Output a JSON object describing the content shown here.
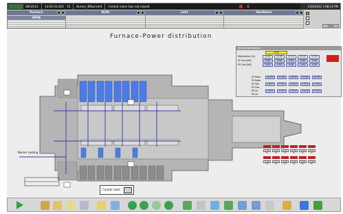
{
  "topbar": {
    "alarm_date": "08/10/12",
    "alarm_time": "14:02:03.625",
    "alarm_count": "15",
    "alarm_source": "Burner_Bfburner6",
    "alarm_message": "Control valve Gas not closed",
    "alarm_code": "E",
    "datetime": "23/4/2012 1:08:33 PM"
  },
  "groups": [
    {
      "title": "Furnace",
      "sub": "EPHA"
    },
    {
      "title": "Bath",
      "sub": ""
    },
    {
      "title": "Lehr",
      "sub": ""
    },
    {
      "title": "Hardware",
      "sub": ""
    }
  ],
  "controls": {
    "select_label": "Qind"
  },
  "main": {
    "title": "Furnace-Power distribution",
    "burner_label": "Burner cooling",
    "control_room_label": "Control room"
  },
  "params": {
    "header": "Window Workstation",
    "mode_value": "0.00",
    "rows": [
      {
        "label": "Distribution [%]",
        "values": [
          "20.00",
          "20.00",
          "20.00",
          "20.00",
          "20.00"
        ]
      },
      {
        "label": "SP Gas [kW]",
        "values": [
          "0.64",
          "0.64",
          "0.64",
          "0.64",
          "0.64"
        ]
      },
      {
        "label": "PV Gas [kW]",
        "values": [
          "0.00",
          "0.00",
          "0.00",
          "0.00",
          "0.00"
        ]
      },
      {
        "label": "SP Ratio",
        "values": [
          "10.00",
          "10.00",
          "10.00",
          "10.00",
          "10.00"
        ]
      },
      {
        "label": "PV Ratio",
        "values": [
          "0.00",
          "0.00",
          "0.00",
          "0.00",
          "0.00"
        ]
      },
      {
        "label": "SP Gas",
        "values": [
          "170.0",
          "170.0",
          "170.0",
          "170.0",
          "170.0"
        ]
      },
      {
        "label": "PV Gas",
        "values": [
          "0.0",
          "0.0",
          "0.0",
          "0.0",
          "0.0"
        ]
      },
      {
        "label": "SP air",
        "values": [
          "170.0",
          "170.0",
          "170.0",
          "170.0",
          "170.0"
        ]
      },
      {
        "label": "PV air",
        "values": [
          "0.0",
          "0.0",
          "0.0",
          "0.0",
          "0.0"
        ]
      }
    ]
  },
  "burner_values": [
    "0.00 %",
    "0.00 %",
    "0.00 %",
    "0.00 %"
  ],
  "mini_table": [
    "0.00 %",
    "0.00 %",
    "0.00 %",
    "0.00 %",
    "0.00 %",
    "0.00 %"
  ],
  "colors": {
    "accent": "#3d6fd8",
    "alarm": "#e02020",
    "ok": "#2ba33a"
  }
}
